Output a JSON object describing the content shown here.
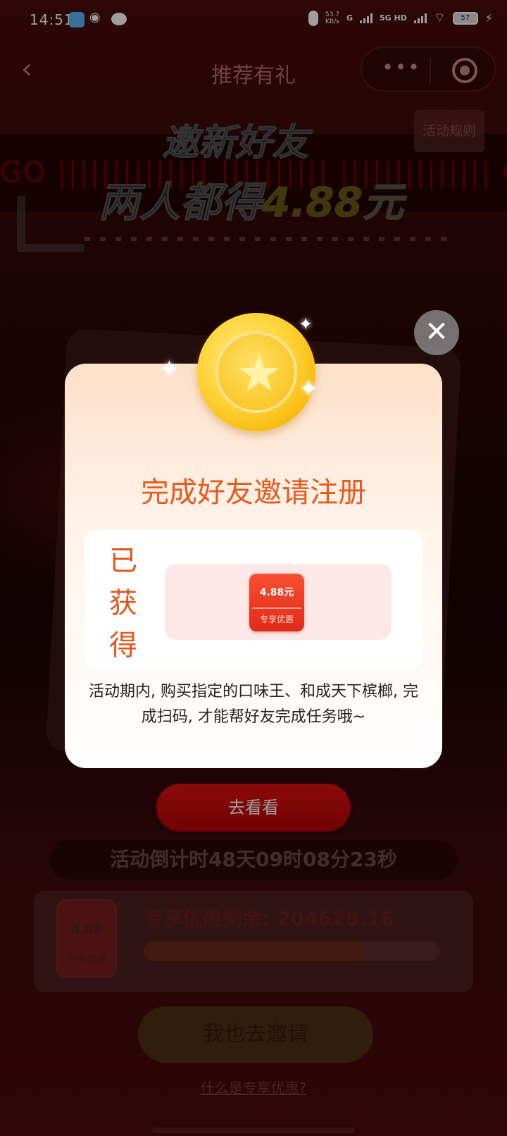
{
  "status_bar": {
    "time": "14:51",
    "net_speed": "53.7",
    "net_unit": "KB/s",
    "signal1": "G",
    "signal2": "5G HD",
    "battery": "57"
  },
  "nav": {
    "back_icon": "chevron-left-icon",
    "title": "推荐有礼"
  },
  "banner": {
    "line1": "邀新好友",
    "line2_prefix": "两人都得",
    "line2_amount": "4.88元",
    "deco": "GO ||||||||||||||  ||||||||||  ||||||||||||||  GO",
    "rules": "活动规则"
  },
  "modal": {
    "title": "完成好友邀请注册",
    "obtained": [
      "已",
      "获",
      "得"
    ],
    "coupon_value": "4.88元",
    "coupon_label": "专享优惠",
    "description": "活动期内, 购买指定的口味王、和成天下槟榔, 完成扫码, 才能帮好友完成任务哦~",
    "close_icon": "close-icon"
  },
  "page": {
    "go_button": "去看看",
    "countdown": "活动倒计时48天09时08分23秒",
    "remain_label": "专享优惠剩余: 204628.16",
    "remain_progress": 0.75,
    "thumb_value": "4.88",
    "thumb_label": "专享优惠",
    "invite_button": "我也去邀请",
    "what_link": "什么是专享优惠?"
  },
  "colors": {
    "accent": "#e55a1e",
    "button_red": "#d10808",
    "coin": "#ffd43a"
  }
}
